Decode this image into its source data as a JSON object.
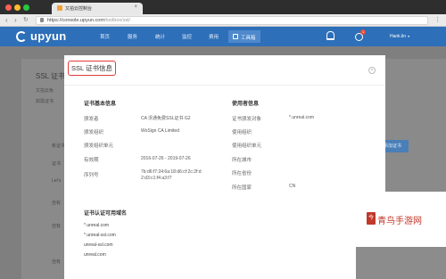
{
  "browser": {
    "tab_title": "又拍云控制台",
    "url_host": "https://console.upyun.com",
    "url_path": "/toolbox/ssl/"
  },
  "app": {
    "logo_text": "upyun",
    "nav": [
      "首页",
      "服务",
      "统计",
      "监控",
      "费用"
    ],
    "nav_active": "工具箱",
    "notif_count": "1",
    "user_name": "Hank.lin"
  },
  "background": {
    "title": "SSL 证书",
    "lines": [
      "又拍云免",
      "如需证书",
      "新证书",
      "证书",
      "Let's",
      "自有",
      "自有",
      "自有"
    ],
    "button_label": "添加证书"
  },
  "modal": {
    "title": "SSL 证书信息",
    "close_label": "×",
    "basic_section": "证书基本信息",
    "basic_labels": [
      "颁发者",
      "颁发组织",
      "颁发组织单元",
      "有效期",
      "序列号"
    ],
    "basic_values": [
      "CA 沃通免费SSL证书 G2",
      "WoSign CA Limited",
      "",
      "2016-07-26 - 2019-07-26",
      "7b:d6:f7:24:6a:18:d6:cf:2c:2f:d2:d3:c1:f4:a3:f7"
    ],
    "user_section": "使用者信息",
    "user_labels": [
      "证书颁发对象",
      "使用组织",
      "使用组织单元",
      "所在城市",
      "所在省份",
      "所在国家"
    ],
    "user_values": [
      "*.unreal.com",
      "",
      "",
      "",
      "",
      "CN"
    ],
    "domains_section": "证书认证可用域名",
    "domains": [
      "*.unreal.com",
      "*.unreal-ssl.com",
      "unreal-ssl.com",
      "unreal.com"
    ]
  },
  "watermark": {
    "seal": "今",
    "text": "青鸟手游网"
  }
}
